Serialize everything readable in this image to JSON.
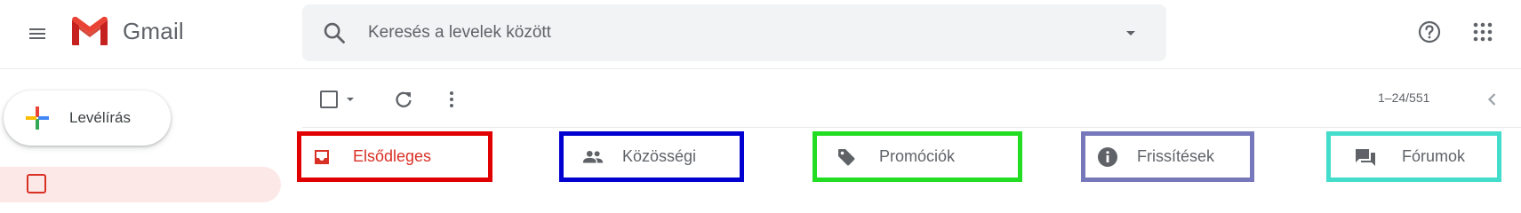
{
  "app": {
    "name": "Gmail"
  },
  "header": {
    "menu_icon": "hamburger-menu-icon",
    "logo_icon": "gmail-m-logo",
    "help_icon": "help-circle-icon",
    "apps_icon": "apps-grid-icon"
  },
  "search": {
    "placeholder": "Keresés a levelek között",
    "value": "",
    "options_icon": "caret-down-icon"
  },
  "sidebar": {
    "compose_label": "Levélírás"
  },
  "toolbar": {
    "pagination": "1–24/551"
  },
  "tabs": [
    {
      "label": "Elsődleges",
      "icon": "inbox-icon",
      "outline": "#e00000",
      "active": true
    },
    {
      "label": "Közösségi",
      "icon": "people-icon",
      "outline": "#0000d0"
    },
    {
      "label": "Promóciók",
      "icon": "tag-icon",
      "outline": "#22dd22"
    },
    {
      "label": "Frissítések",
      "icon": "info-icon",
      "outline": "#7777bb"
    },
    {
      "label": "Fórumok",
      "icon": "forum-icon",
      "outline": "#44ddcc"
    }
  ],
  "colors": {
    "accent_red": "#d93025",
    "text_gray": "#5f6368",
    "search_bg": "#f1f3f4"
  }
}
